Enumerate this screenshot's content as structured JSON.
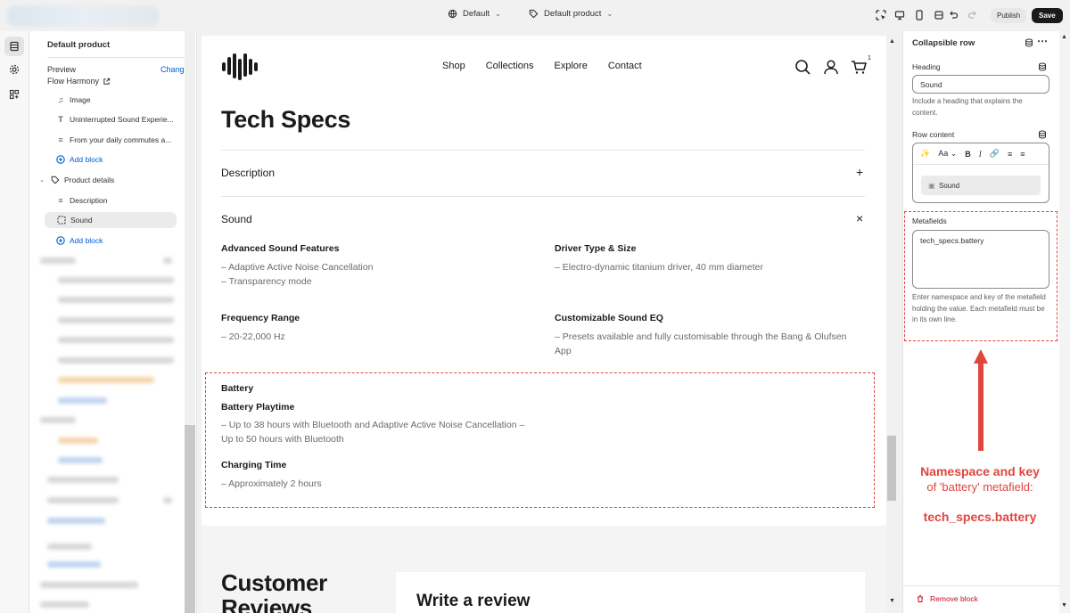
{
  "topbar": {
    "theme_select": "Default",
    "template_select": "Default product",
    "publish_label": "Publish",
    "save_label": "Save"
  },
  "sidebar": {
    "title": "Default product",
    "preview_label": "Preview",
    "change_label": "Change",
    "preview_product": "Flow Harmony",
    "items": [
      {
        "label": "Image",
        "icon": "image-icon"
      },
      {
        "label": "Uninterrupted Sound Experie...",
        "icon": "text-icon"
      },
      {
        "label": "From your daily commutes a...",
        "icon": "paragraph-icon"
      },
      {
        "label": "Add block",
        "icon": "add-icon"
      },
      {
        "label": "Product details",
        "icon": "tag-icon"
      },
      {
        "label": "Description",
        "icon": "paragraph-icon"
      },
      {
        "label": "Sound",
        "icon": "collapsible-icon"
      },
      {
        "label": "Add block",
        "icon": "add-icon"
      }
    ]
  },
  "preview": {
    "nav": [
      "Shop",
      "Collections",
      "Explore",
      "Contact"
    ],
    "cart_count": "1",
    "title": "Tech Specs",
    "accordion": [
      {
        "label": "Description",
        "state": "+"
      },
      {
        "label": "Sound",
        "state": "×"
      }
    ],
    "specs": {
      "advanced_h": "Advanced Sound Features",
      "advanced_1": "– Adaptive Active Noise Cancellation",
      "advanced_2": "– Transparency mode",
      "driver_h": "Driver Type & Size",
      "driver_t": "– Electro-dynamic titanium driver, 40 mm diameter",
      "freq_h": "Frequency Range",
      "freq_t": "– 20-22,000 Hz",
      "eq_h": "Customizable Sound EQ",
      "eq_1": "– Presets available and fully customisable through the Bang & Olufsen",
      "eq_2": "App",
      "battery_h": "Battery",
      "playtime_h": "Battery Playtime",
      "playtime_1": "– Up to 38 hours with Bluetooth and Adaptive Active Noise Cancellation –",
      "playtime_2": "Up to 50 hours with Bluetooth",
      "charging_h": "Charging Time",
      "charging_t": "– Approximately 2 hours"
    },
    "reviews_title_1": "Customer",
    "reviews_title_2": "Reviews",
    "write_review": "Write a review"
  },
  "rpanel": {
    "title": "Collapsible row",
    "heading_label": "Heading",
    "heading_value": "Sound",
    "heading_help": "Include a heading that explains the content.",
    "row_content_label": "Row content",
    "row_content_chip": "Sound",
    "metafields_label": "Metafields",
    "metafields_value": "tech_specs.battery",
    "metafields_help": "Enter namespace and key of the metafield holding the value. Each metafield must be in its own line.",
    "remove_label": "Remove block"
  },
  "annotation": {
    "line1": "Namespace and key",
    "line2": "of 'battery' metafield:",
    "key": "tech_specs.battery",
    "color": "#e0463e"
  }
}
